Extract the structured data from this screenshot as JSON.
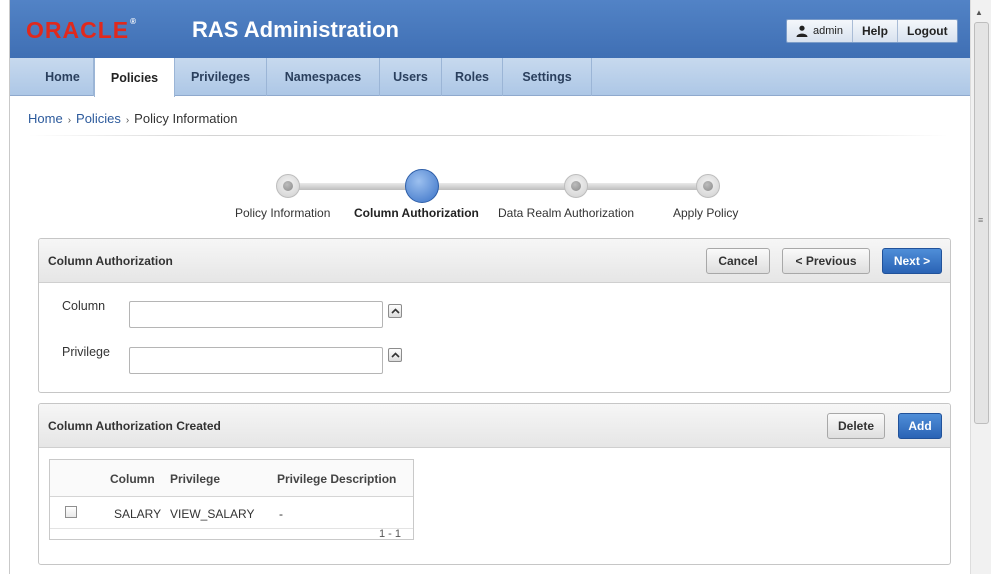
{
  "header": {
    "logo": "ORACLE",
    "logo_mark": "®",
    "title": "RAS Administration",
    "user": "admin",
    "help": "Help",
    "logout": "Logout"
  },
  "tabs": [
    {
      "label": "Home"
    },
    {
      "label": "Policies"
    },
    {
      "label": "Privileges"
    },
    {
      "label": "Namespaces"
    },
    {
      "label": "Users"
    },
    {
      "label": "Roles"
    },
    {
      "label": "Settings"
    }
  ],
  "breadcrumb": {
    "items": [
      "Home",
      "Policies",
      "Policy Information"
    ],
    "separator": "›"
  },
  "train": {
    "steps": [
      "Policy Information",
      "Column Authorization",
      "Data Realm Authorization",
      "Apply Policy"
    ],
    "current": "Column Authorization"
  },
  "column_auth": {
    "title": "Column Authorization",
    "cancel": "Cancel",
    "previous": "< Previous",
    "next": "Next >",
    "column_label": "Column",
    "column_value": "",
    "privilege_label": "Privilege",
    "privilege_value": ""
  },
  "created": {
    "title": "Column Authorization Created",
    "delete": "Delete",
    "add": "Add",
    "headers": [
      "Column",
      "Privilege",
      "Privilege Description"
    ],
    "rows": [
      {
        "column": "SALARY",
        "privilege": "VIEW_SALARY",
        "description": "-"
      }
    ],
    "pagination": "1 - 1"
  },
  "colors": {
    "header_blue": "#4a7bbf",
    "oracle_red": "#e0291d",
    "button_blue": "#2a63b5"
  }
}
